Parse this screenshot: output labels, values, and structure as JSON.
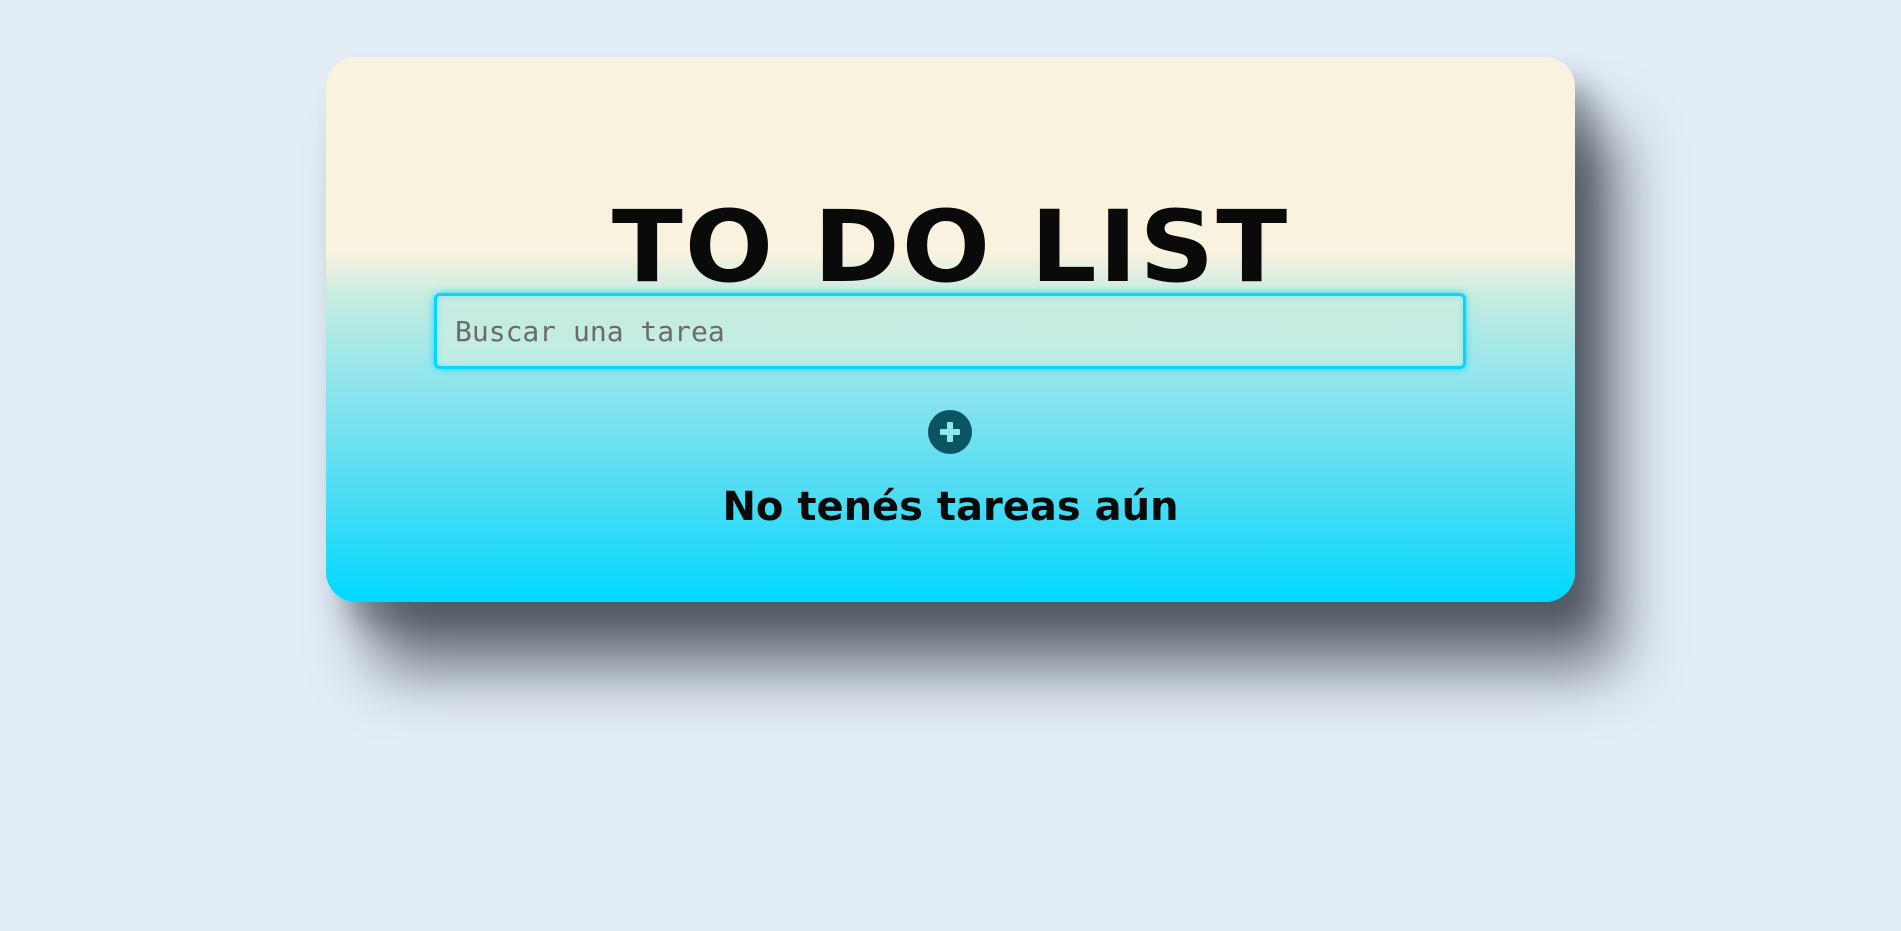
{
  "app": {
    "title": "TO DO LIST"
  },
  "search": {
    "value": "",
    "placeholder": "Buscar una tarea"
  },
  "add_button": {
    "icon": "plus-circle-icon",
    "color": "#0b5462"
  },
  "tasks": {
    "items": [],
    "empty_message": "No tenés tareas aún"
  },
  "colors": {
    "background": "#e3edf6",
    "card_top": "#f9f2df",
    "card_bottom": "#00d8ff",
    "input_border": "#06d6ff",
    "text": "#0a0a0a"
  }
}
